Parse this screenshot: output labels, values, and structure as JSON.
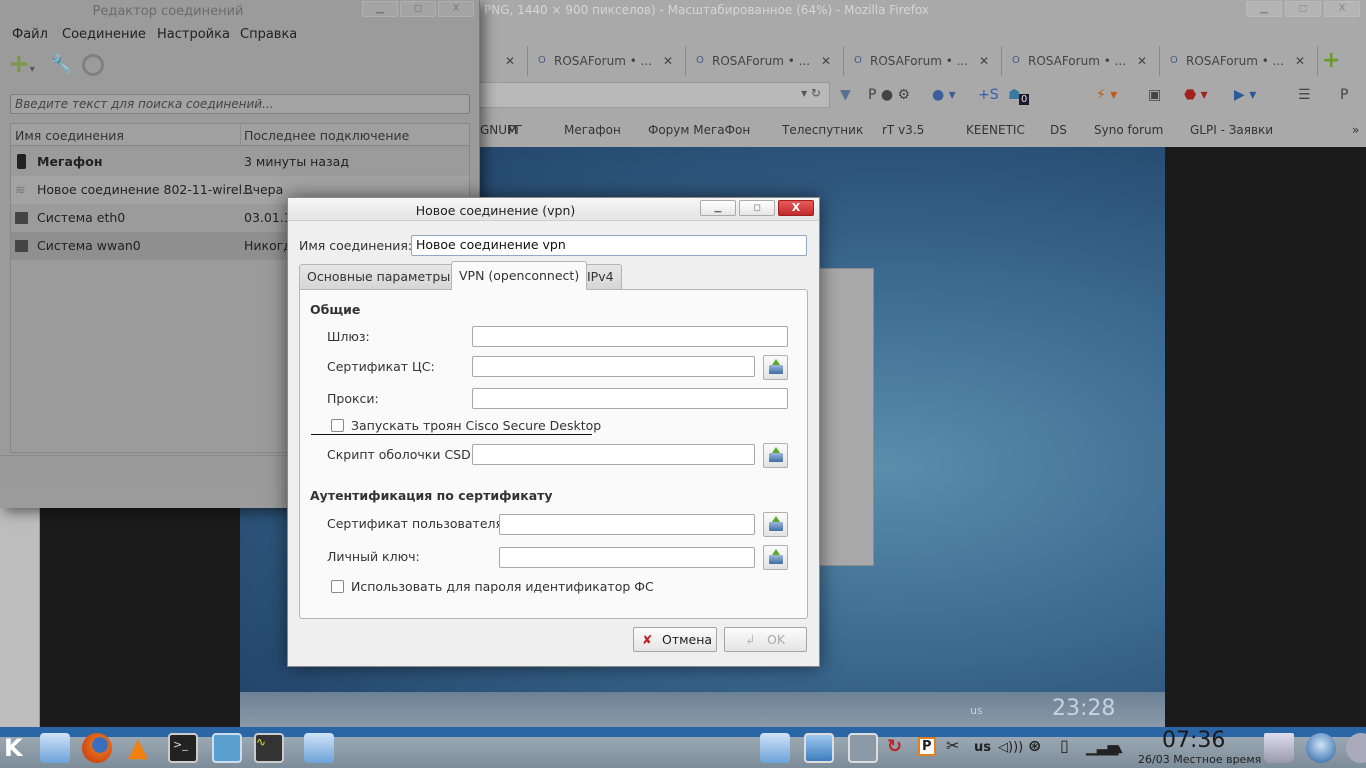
{
  "firefox": {
    "title": "PNG, 1440 × 900 пикселов) - Масштабированное (64%) - Mozilla Firefox",
    "tabs": [
      {
        "label": "ROSAForum • ..."
      },
      {
        "label": "ROSAForum • ..."
      },
      {
        "label": "ROSAForum • ..."
      },
      {
        "label": "ROSAForum • ..."
      },
      {
        "label": "ROSAForum • ..."
      }
    ],
    "ghost_badge": "0",
    "bookmarks": [
      "GNUM",
      "РГ",
      "Мегафон",
      "Форум МегаФон",
      "Телеспутник",
      "rT v3.5",
      "KEENETIC",
      "DS",
      "Syno forum",
      "GLPI - Заявки"
    ],
    "more": "»"
  },
  "editor": {
    "title": "Редактор соединений",
    "menu": [
      "Файл",
      "Соединение",
      "Настройка",
      "Справка"
    ],
    "search_placeholder": "Введите текст для поиска соединений...",
    "columns": [
      "Имя соединения",
      "Последнее подключение"
    ],
    "rows": [
      {
        "name": "Мегафон",
        "last": "3 минуты назад",
        "icon": "phone-icon"
      },
      {
        "name": "Новое соединение 802-11-wirel...",
        "last": "Вчера",
        "icon": "wifi-icon"
      },
      {
        "name": "Система eth0",
        "last": "03.01.15",
        "icon": "network-icon"
      },
      {
        "name": "Система wwan0",
        "last": "Никогда",
        "icon": "network-icon"
      }
    ]
  },
  "dialog": {
    "title": "Новое соединение (vpn)",
    "name_label": "Имя соединения:",
    "name_value": "Новое соединение vpn",
    "tabs": [
      "Основные параметры",
      "VPN (openconnect)",
      "IPv4"
    ],
    "general_heading": "Общие",
    "gateway_label": "Шлюз:",
    "ca_label": "Сертификат ЦС:",
    "proxy_label": "Прокси:",
    "csd_checkbox": "Запускать троян Cisco Secure Desktop",
    "csd_script_label": "Скрипт оболочки CSD:",
    "auth_heading": "Аутентификация по сертификату",
    "user_cert_label": "Сертификат пользователя:",
    "key_label": "Личный ключ:",
    "fsid_checkbox": "Использовать для пароля идентификатор ФС",
    "cancel": "Отмена",
    "ok": "OK"
  },
  "screenshot_panel": {
    "clock": "23:28",
    "layout": "us"
  },
  "taskbar": {
    "layout": "us",
    "time": "07:36",
    "date": "26/03 Местное время"
  }
}
